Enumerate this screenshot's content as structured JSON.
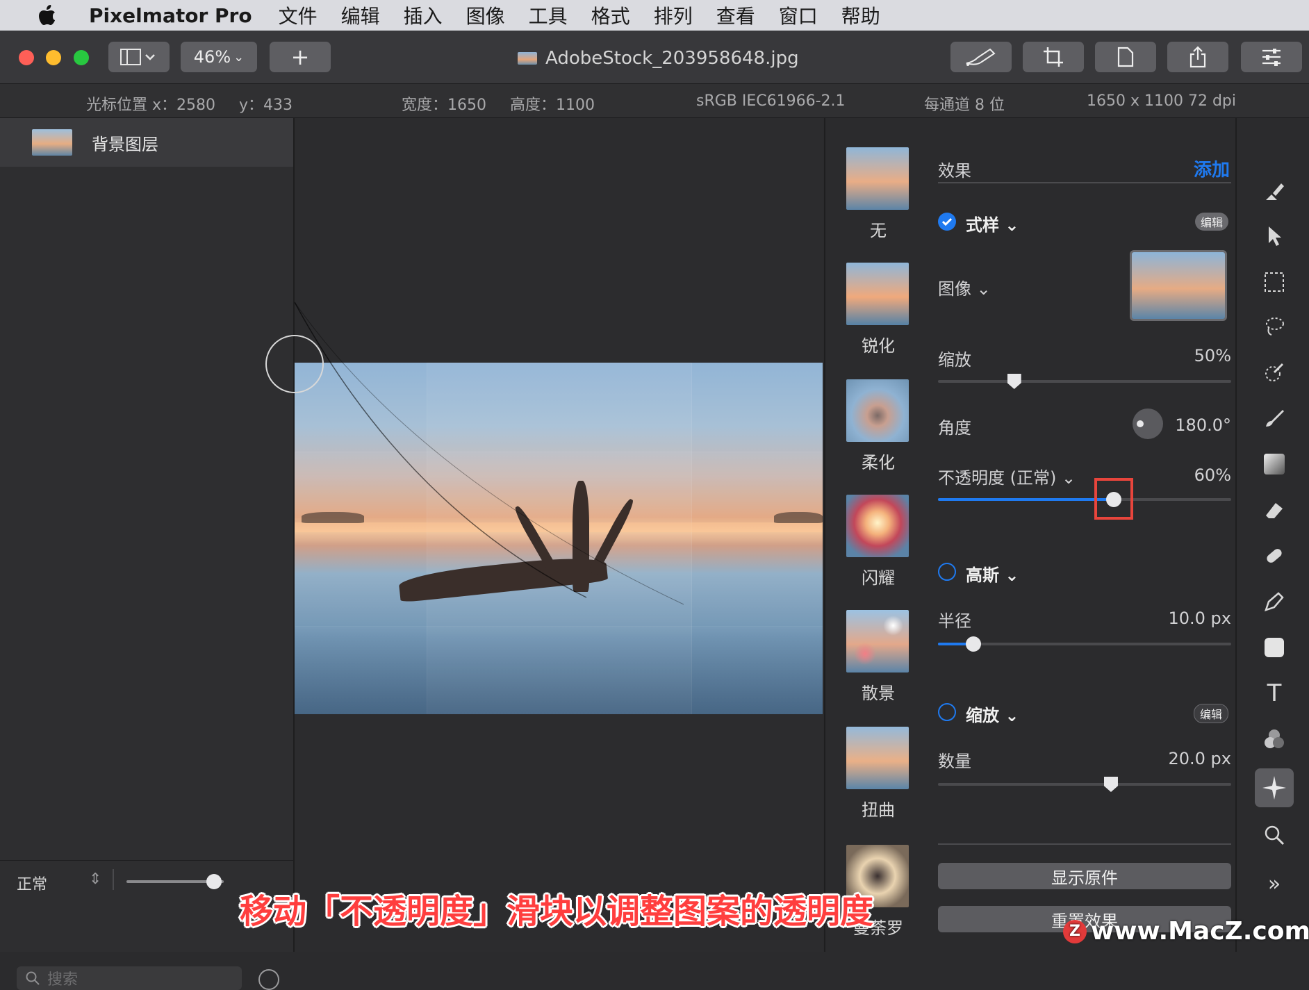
{
  "menubar": {
    "app": "Pixelmator Pro",
    "items": [
      "文件",
      "编辑",
      "插入",
      "图像",
      "工具",
      "格式",
      "排列",
      "查看",
      "窗口",
      "帮助"
    ]
  },
  "toolbar": {
    "zoom": "46%",
    "add": "+",
    "document_title": "AdobeStock_203958648.jpg"
  },
  "infobar": {
    "cursor_x": "光标位置 x：2580",
    "cursor_y": "y：433",
    "width": "宽度：1650",
    "height": "高度：1100",
    "color_profile": "sRGB IEC61966-2.1",
    "bit_depth": "每通道 8 位",
    "resolution": "1650 x 1100 72 dpi"
  },
  "layers": {
    "items": [
      {
        "name": "背景图层"
      }
    ],
    "blend_mode": "正常",
    "opacity_fraction": 0.9,
    "search_placeholder": "搜索"
  },
  "presets": [
    {
      "label": "无"
    },
    {
      "label": "锐化"
    },
    {
      "label": "柔化"
    },
    {
      "label": "闪耀"
    },
    {
      "label": "散景"
    },
    {
      "label": "扭曲"
    },
    {
      "label": "曼荼罗"
    }
  ],
  "effects": {
    "header": "效果",
    "add": "添加",
    "pattern": {
      "title": "式样",
      "enabled": true,
      "edit": "编辑",
      "image_label": "图像",
      "scale_label": "缩放",
      "scale_value": "50%",
      "scale_fraction": 0.26,
      "angle_label": "角度",
      "angle_value": "180.0°",
      "opacity_label": "不透明度 (正常)",
      "opacity_value": "60%",
      "opacity_fraction": 0.6
    },
    "gaussian": {
      "title": "高斯",
      "enabled": false,
      "radius_label": "半径",
      "radius_value": "10.0 px",
      "radius_fraction": 0.12
    },
    "zoom": {
      "title": "缩放",
      "enabled": false,
      "edit": "编辑",
      "amount_label": "数量",
      "amount_value": "20.0 px",
      "amount_fraction": 0.59
    },
    "show_original": "显示原件",
    "reset": "重置效果"
  },
  "caption": "移动「不透明度」滑块以调整图案的透明度",
  "watermark": "www.MacZ.com",
  "colors": {
    "accent": "#1f7af0",
    "highlight": "#e8453c"
  }
}
